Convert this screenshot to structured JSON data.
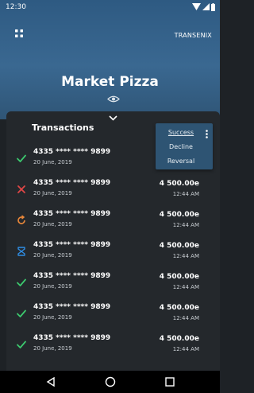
{
  "status_bar": {
    "time": "12:30"
  },
  "header": {
    "brand": "TRANSENIX",
    "merchant_name": "Market Pizza"
  },
  "transactions": {
    "title": "Transactions",
    "items": [
      {
        "status": "success",
        "status_color": "#3cc86e",
        "card": "4335 **** **** 9899",
        "date": "20 June, 2019",
        "amount": "4 500.00",
        "currency": "e",
        "time": "12:44 AM"
      },
      {
        "status": "declined",
        "status_color": "#e04646",
        "card": "4335 **** **** 9899",
        "date": "20 June, 2019",
        "amount": "4 500.00",
        "currency": "e",
        "time": "12:44 AM"
      },
      {
        "status": "reversal",
        "status_color": "#e8873a",
        "card": "4335 **** **** 9899",
        "date": "20 June, 2019",
        "amount": "4 500.00",
        "currency": "e",
        "time": "12:44 AM"
      },
      {
        "status": "pending",
        "status_color": "#2f8de4",
        "card": "4335 **** **** 9899",
        "date": "20 June, 2019",
        "amount": "4 500.00",
        "currency": "e",
        "time": "12:44 AM"
      },
      {
        "status": "success",
        "status_color": "#3cc86e",
        "card": "4335 **** **** 9899",
        "date": "20 June, 2019",
        "amount": "4 500.00",
        "currency": "e",
        "time": "12:44 AM"
      },
      {
        "status": "success",
        "status_color": "#3cc86e",
        "card": "4335 **** **** 9899",
        "date": "20 June, 2019",
        "amount": "4 500.00",
        "currency": "e",
        "time": "12:44 AM"
      },
      {
        "status": "success",
        "status_color": "#3cc86e",
        "card": "4335 **** **** 9899",
        "date": "20 June, 2019",
        "amount": "4 500.00",
        "currency": "e",
        "time": "12:44 AM"
      }
    ]
  },
  "filter_menu": {
    "options": [
      "Success",
      "Decline",
      "Reversal"
    ],
    "selected": "Success"
  },
  "colors": {
    "header_bg": "#3a6891",
    "sheet_bg": "#24282c",
    "popup_bg": "#2e5473"
  }
}
